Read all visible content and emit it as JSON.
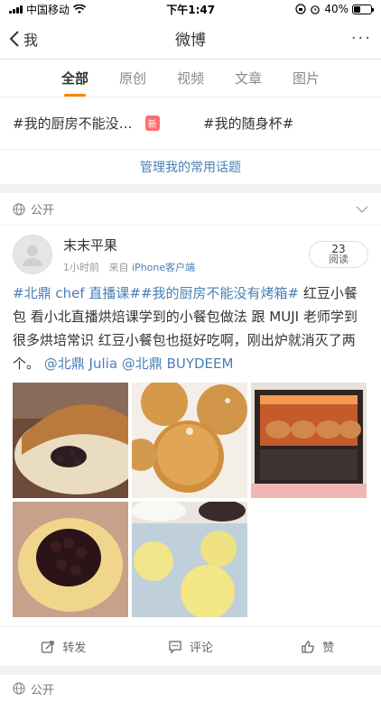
{
  "status": {
    "carrier": "中国移动",
    "time": "下午1:47",
    "battery": "40%"
  },
  "nav": {
    "back_label": "我",
    "title": "微博",
    "more": "···"
  },
  "tabs": [
    "全部",
    "原创",
    "视频",
    "文章",
    "图片"
  ],
  "topics": {
    "left": "#我的厨房不能没…",
    "left_badge": "新",
    "right": "#我的随身杯#"
  },
  "manage_label": "管理我的常用话题",
  "privacy_label": "公开",
  "post": {
    "user": "末末平果",
    "time": "1小时前",
    "source_prefix": "来自",
    "source": "iPhone客户端",
    "reads_count": "23",
    "reads_label": "阅读",
    "text": {
      "hashtag1": "#北鼎 chef 直播课#",
      "hashtag2": "#我的厨房不能没有烤箱#",
      "body": " 红豆小餐包 看小北直播烘焙课学到的小餐包做法 跟 MUJI 老师学到很多烘培常识 红豆小餐包也挺好吃啊，刚出炉就消灭了两个。 ",
      "mention1": "@北鼎 Julia",
      "mention2": "@北鼎 BUYDEEM"
    }
  },
  "actions": {
    "repost": "转发",
    "comment": "评论",
    "like": "赞"
  },
  "next_privacy": "公开"
}
